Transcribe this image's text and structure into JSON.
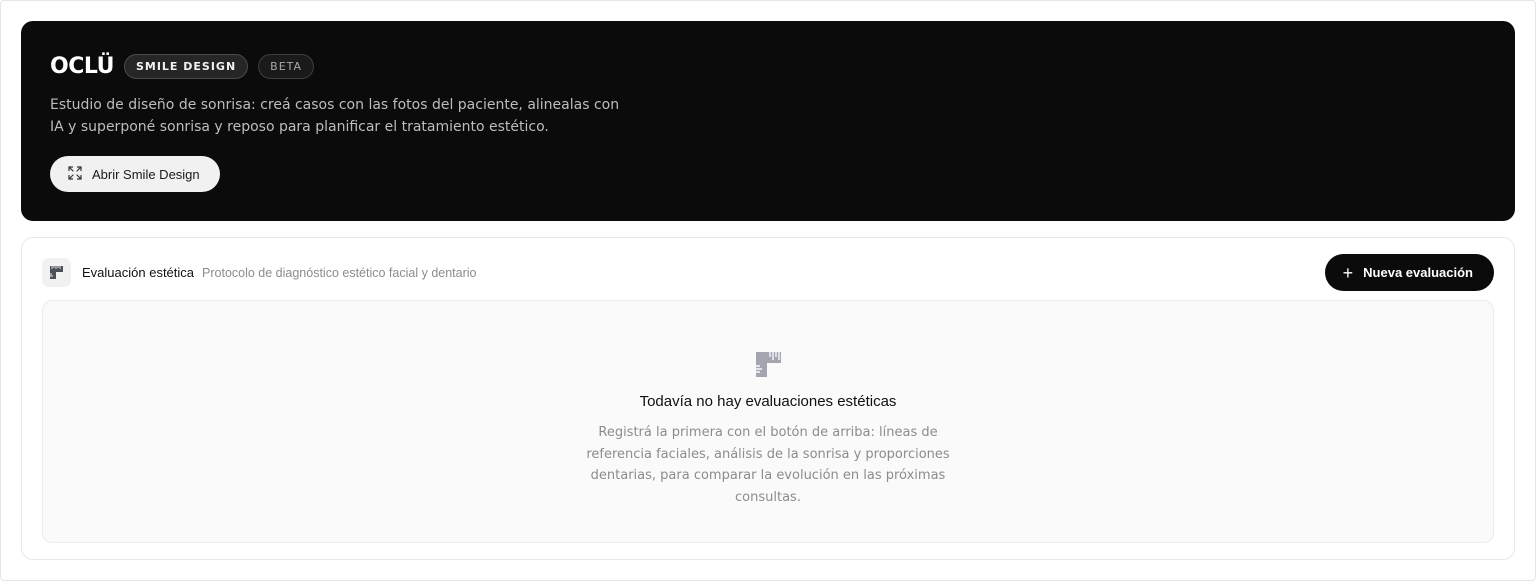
{
  "hero": {
    "brand": "OCLÜ",
    "badges": [
      "SMILE DESIGN",
      "BETA"
    ],
    "description": "Estudio de diseño de sonrisa: creá casos con las fotos del paciente, alinealas con IA y superponé sonrisa y reposo para planificar el tratamiento estético.",
    "open_button_label": "Abrir Smile Design",
    "open_button_icon": "expand-icon"
  },
  "evaluation": {
    "icon": "ruler-icon",
    "title": "Evaluación estética",
    "subtitle": "Protocolo de diagnóstico estético facial y dentario",
    "new_button_label": "Nueva evaluación",
    "new_button_icon": "plus-icon",
    "empty": {
      "icon": "ruler-icon",
      "title": "Todavía no hay evaluaciones estéticas",
      "description": "Registrá la primera con el botón de arriba: líneas de referencia faciales, análisis de la sonrisa y proporciones dentarias, para comparar la evolución en las próximas consultas."
    }
  },
  "colors": {
    "hero_bg": "#0b0b0b",
    "primary_button_bg": "#0b0b0b",
    "icon_gray": "#a3a6b0"
  }
}
